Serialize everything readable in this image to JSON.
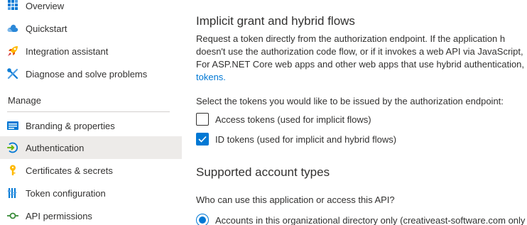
{
  "sidebar": {
    "items": [
      {
        "label": "Overview",
        "icon": "overview-grid-icon"
      },
      {
        "label": "Quickstart",
        "icon": "cloud-icon"
      },
      {
        "label": "Integration assistant",
        "icon": "rocket-icon"
      },
      {
        "label": "Diagnose and solve problems",
        "icon": "wrench-icon"
      }
    ],
    "section_header": "Manage",
    "manage_items": [
      {
        "label": "Branding & properties",
        "icon": "branding-icon"
      },
      {
        "label": "Authentication",
        "icon": "authentication-icon",
        "active": true
      },
      {
        "label": "Certificates & secrets",
        "icon": "key-icon"
      },
      {
        "label": "Token configuration",
        "icon": "token-bars-icon"
      },
      {
        "label": "API permissions",
        "icon": "api-permissions-icon"
      }
    ]
  },
  "main": {
    "implicit": {
      "title": "Implicit grant and hybrid flows",
      "description_lines": [
        "Request a token directly from the authorization endpoint. If the application h",
        "doesn't use the authorization code flow, or if it invokes a web API via JavaScript,",
        "For ASP.NET Core web apps and other web apps that use hybrid authentication,"
      ],
      "description_link": "tokens.",
      "prompt": "Select the tokens you would like to be issued by the authorization endpoint:",
      "options": [
        {
          "label": "Access tokens (used for implicit flows)",
          "checked": false
        },
        {
          "label": "ID tokens (used for implicit and hybrid flows)",
          "checked": true
        }
      ]
    },
    "account_types": {
      "title": "Supported account types",
      "prompt": "Who can use this application or access this API?",
      "options": [
        {
          "label": "Accounts in this organizational directory only (creativeast-software.com only",
          "selected": true
        }
      ]
    }
  },
  "colors": {
    "accent": "#0078d4",
    "active_bg": "#edebe9",
    "text": "#323130"
  }
}
